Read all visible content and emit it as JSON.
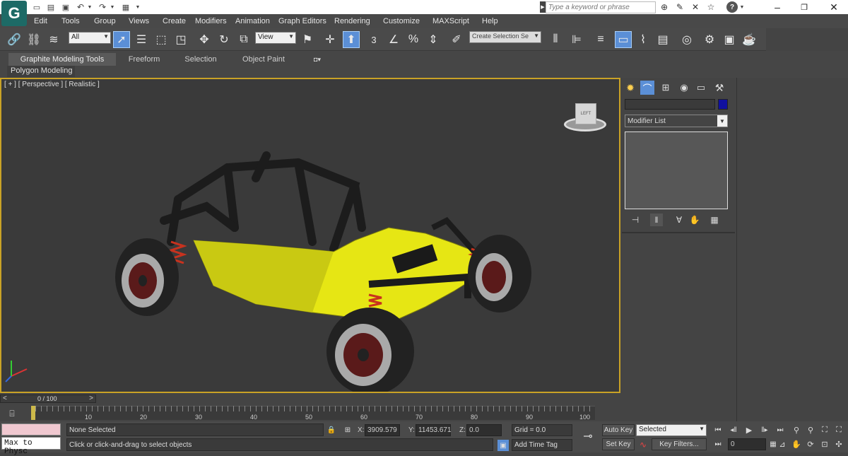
{
  "titlebar": {
    "search_placeholder": "Type a keyword or phrase",
    "help_label": "?"
  },
  "menu": [
    "Edit",
    "Tools",
    "Group",
    "Views",
    "Create",
    "Modifiers",
    "Animation",
    "Graph Editors",
    "Rendering",
    "Customize",
    "MAXScript",
    "Help"
  ],
  "toolbar": {
    "selection_filter": "All",
    "ref_coord": "View",
    "snap_3": "3",
    "named_selection_placeholder": "Create Selection Se"
  },
  "ribbon": {
    "tabs": [
      "Graphite Modeling Tools",
      "Freeform",
      "Selection",
      "Object Paint"
    ],
    "sub_tab": "Polygon Modeling"
  },
  "viewport": {
    "label": "[ + ] [ Perspective ] [ Realistic ]",
    "viewcube_label": "LEFT"
  },
  "command_panel": {
    "modifier_list": "Modifier List",
    "color_swatch": "#1010a0"
  },
  "timeline": {
    "frame_label": "0 / 100",
    "ticks": [
      "10",
      "20",
      "30",
      "40",
      "50",
      "60",
      "70",
      "80",
      "90",
      "100"
    ]
  },
  "status": {
    "maxscript_listener": "Max to Physc",
    "selection_status": "None Selected",
    "prompt": "Click or click-and-drag to select objects",
    "x_label": "X:",
    "x_value": "3909.579",
    "y_label": "Y:",
    "y_value": "11453.671",
    "z_label": "Z:",
    "z_value": "0.0",
    "grid": "Grid = 0.0",
    "add_time_tag": "Add Time Tag",
    "auto_key": "Auto Key",
    "set_key": "Set Key",
    "key_mode": "Selected",
    "key_filters": "Key Filters...",
    "current_frame": "0"
  },
  "colors": {
    "accent": "#5b8fd6",
    "viewport_border": "#c9a226",
    "buggy_body": "#e6e614"
  }
}
